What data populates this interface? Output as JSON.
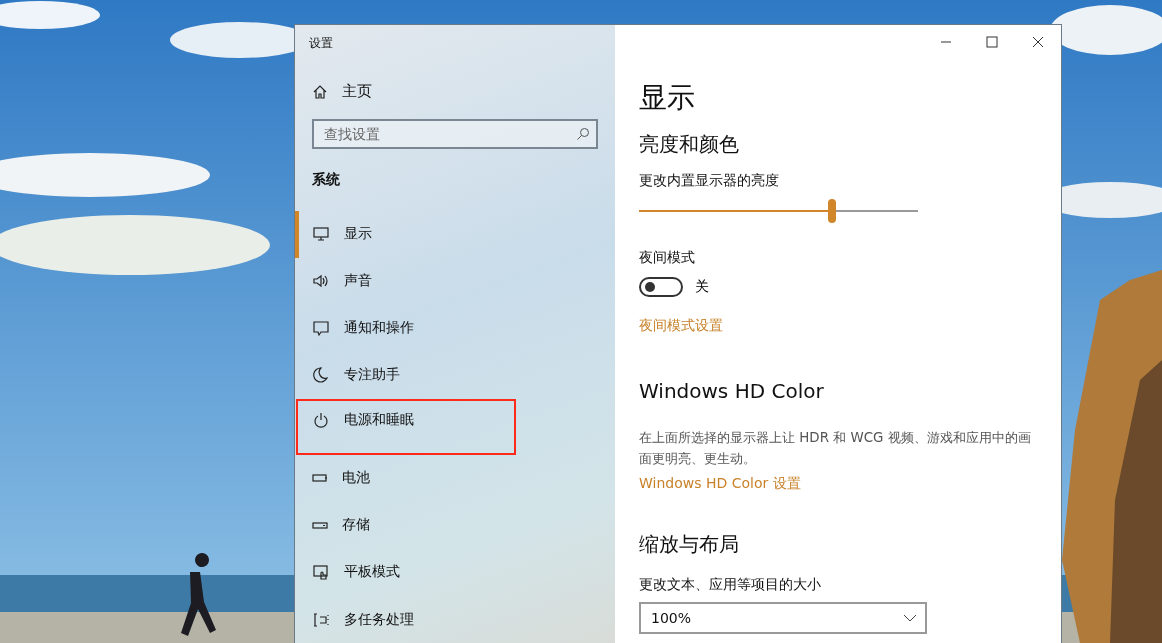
{
  "window": {
    "title": "设置"
  },
  "sidebar": {
    "home": "主页",
    "search": {
      "placeholder": "查找设置"
    },
    "section": "系统",
    "items": [
      {
        "label": "显示",
        "selected": true,
        "annotated": false
      },
      {
        "label": "声音",
        "selected": false,
        "annotated": false
      },
      {
        "label": "通知和操作",
        "selected": false,
        "annotated": false
      },
      {
        "label": "专注助手",
        "selected": false,
        "annotated": false
      },
      {
        "label": "电源和睡眠",
        "selected": false,
        "annotated": true
      },
      {
        "label": "电池",
        "selected": false,
        "annotated": false
      },
      {
        "label": "存储",
        "selected": false,
        "annotated": false
      },
      {
        "label": "平板模式",
        "selected": false,
        "annotated": false
      },
      {
        "label": "多任务处理",
        "selected": false,
        "annotated": false
      }
    ]
  },
  "content": {
    "title": "显示",
    "brightness": {
      "heading": "亮度和颜色",
      "label": "更改内置显示器的亮度",
      "level": 0.69
    },
    "night_mode": {
      "label": "夜间模式",
      "on": false,
      "state": "关",
      "link": "夜间模式设置"
    },
    "hd_color": {
      "heading": "Windows HD Color",
      "description": "在上面所选择的显示器上让 HDR 和 WCG 视频、游戏和应用中的画面更明亮、更生动。",
      "link": "Windows HD Color 设置"
    },
    "scale": {
      "heading": "缩放与布局",
      "label": "更改文本、应用等项目的大小",
      "value": "100%"
    }
  }
}
